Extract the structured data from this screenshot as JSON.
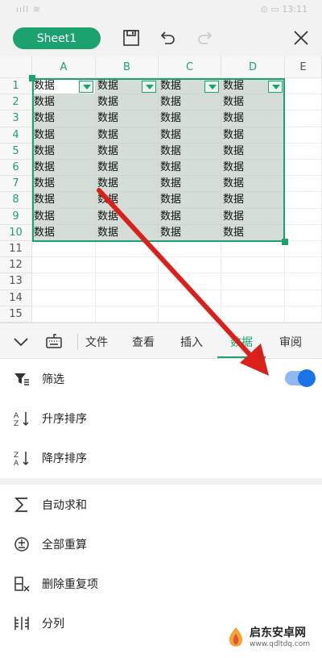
{
  "status_bar": {
    "left": "ııll ≋",
    "right": "⊙ ▭ 13:11"
  },
  "toolbar": {
    "sheet_name": "Sheet1",
    "save_icon": "save-icon",
    "undo_icon": "undo-icon",
    "redo_icon": "redo-icon",
    "close_icon": "close-icon"
  },
  "grid": {
    "columns": [
      "A",
      "B",
      "C",
      "D",
      "E"
    ],
    "rows": [
      "1",
      "2",
      "3",
      "4",
      "5",
      "6",
      "7",
      "8",
      "9",
      "10",
      "11",
      "12",
      "13",
      "14",
      "15"
    ],
    "cell_text": "数据",
    "selected_rows": 10,
    "selected_cols": 4,
    "accent": "#1ba26f",
    "selection_fill": "#d5ddd7"
  },
  "ribbon": {
    "tabs": [
      "文件",
      "查看",
      "插入",
      "数据",
      "审阅"
    ],
    "active_tab": "数据"
  },
  "menu": {
    "items": [
      {
        "label": "筛选",
        "icon": "filter-icon",
        "toggle": true
      },
      {
        "label": "升序排序",
        "icon": "sort-ascending-icon"
      },
      {
        "label": "降序排序",
        "icon": "sort-descending-icon"
      },
      {
        "label": "自动求和",
        "icon": "sum-icon"
      },
      {
        "label": "全部重算",
        "icon": "recalculate-icon"
      },
      {
        "label": "删除重复项",
        "icon": "remove-duplicates-icon"
      },
      {
        "label": "分列",
        "icon": "split-columns-icon"
      }
    ],
    "toggle_color": "#1a73e8"
  },
  "annotation": {
    "arrow_color": "#d9201a"
  },
  "watermark": {
    "name": "启东安卓网",
    "url": "www.qdltdq.com"
  }
}
